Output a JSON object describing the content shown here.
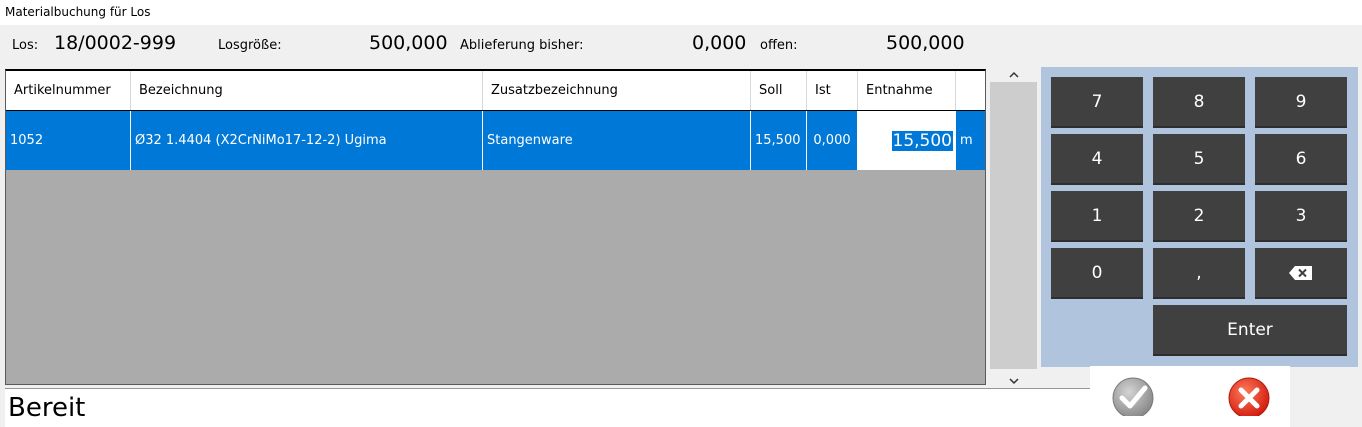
{
  "window": {
    "title": "Materialbuchung für Los"
  },
  "header": {
    "los_label": "Los:",
    "los_value": "18/0002-999",
    "losgroesse_label": "Losgröße:",
    "losgroesse_value": "500,000",
    "ablieferung_label": "Ablieferung bisher:",
    "ablieferung_value": "0,000",
    "offen_label": "offen:",
    "offen_value": "500,000"
  },
  "table": {
    "columns": [
      "Artikelnummer",
      "Bezeichnung",
      "Zusatzbezeichnung",
      "Soll",
      "Ist",
      "Entnahme"
    ],
    "rows": [
      {
        "artikelnummer": "1052",
        "bezeichnung": "Ø32 1.4404 (X2CrNiMo17-12-2) Ugima",
        "zusatz": "Stangenware",
        "soll": "15,500",
        "ist": "0,000",
        "entnahme": "15,500",
        "einheit": "m"
      }
    ]
  },
  "scrollbar": {
    "up_icon": "chevron-up",
    "down_icon": "chevron-down"
  },
  "keypad": {
    "keys": [
      "7",
      "8",
      "9",
      "4",
      "5",
      "6",
      "1",
      "2",
      "3",
      "0",
      ","
    ],
    "backspace_icon": "backspace",
    "enter_label": "Enter"
  },
  "status": {
    "text": "Bereit"
  },
  "actions": {
    "ok_icon": "checkmark",
    "cancel_icon": "close"
  },
  "colors": {
    "selection": "#0078d7",
    "keypad_bg": "#b0c4de",
    "key_bg": "#404040",
    "cancel_red": "#e53020",
    "ok_gray": "#9a9a9a"
  }
}
